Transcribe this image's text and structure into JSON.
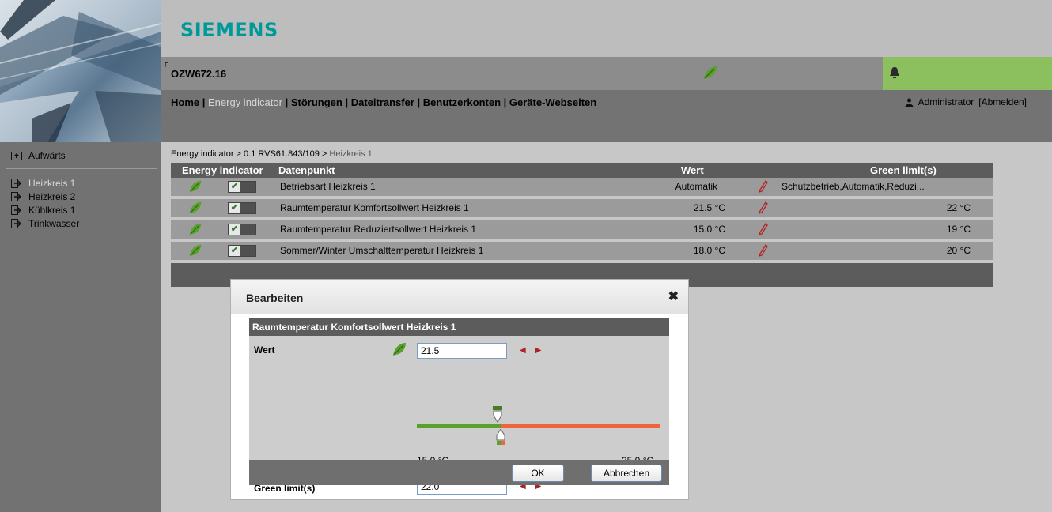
{
  "brand": {
    "logo": "SIEMENS"
  },
  "device": {
    "name": "OZW672.16"
  },
  "colors": {
    "leaf_green": "#5aa02c",
    "alarm_bg": "#8cbf5e",
    "slider_red": "#f0643c",
    "siemens_teal": "#009999"
  },
  "nav": {
    "home": "Home",
    "sep": " | ",
    "energy": "Energy indicator",
    "faults": "Störungen",
    "filetransfer": "Dateitransfer",
    "accounts": "Benutzerkonten",
    "webpages": "Geräte-Webseiten"
  },
  "user": {
    "name": "Administrator",
    "logout": "[Abmelden]"
  },
  "sidebar": {
    "up": "Aufwärts",
    "items": [
      {
        "label": "Heizkreis 1"
      },
      {
        "label": "Heizkreis 2"
      },
      {
        "label": "Kühlkreis 1"
      },
      {
        "label": "Trinkwasser"
      }
    ]
  },
  "breadcrumb": {
    "path": "Energy indicator > 0.1 RVS61.843/109 > ",
    "current": "Heizkreis 1"
  },
  "table": {
    "headers": {
      "energy": "Energy indicator",
      "datapoint": "Datenpunkt",
      "value": "Wert",
      "green": "Green limit(s)"
    },
    "rows": [
      {
        "datapoint": "Betriebsart Heizkreis 1",
        "value": "Automatik",
        "green": "Schutzbetrieb,Automatik,Reduzi..."
      },
      {
        "datapoint": "Raumtemperatur Komfortsollwert Heizkreis 1",
        "value": "21.5 °C",
        "green": "22 °C"
      },
      {
        "datapoint": "Raumtemperatur Reduziertsollwert Heizkreis 1",
        "value": "15.0 °C",
        "green": "19 °C"
      },
      {
        "datapoint": "Sommer/Winter Umschalttemperatur Heizkreis 1",
        "value": "18.0 °C",
        "green": "20 °C"
      }
    ]
  },
  "dialog": {
    "title": "Bearbeiten",
    "close": "✖",
    "panel_title": "Raumtemperatur Komfortsollwert Heizkreis 1",
    "value_label": "Wert",
    "value": "21.5",
    "min": "15.0 °C",
    "max": "35.0 °C",
    "green_label": "Green limit(s)",
    "green_value": "22.0",
    "ok": "OK",
    "cancel": "Abbrechen"
  }
}
